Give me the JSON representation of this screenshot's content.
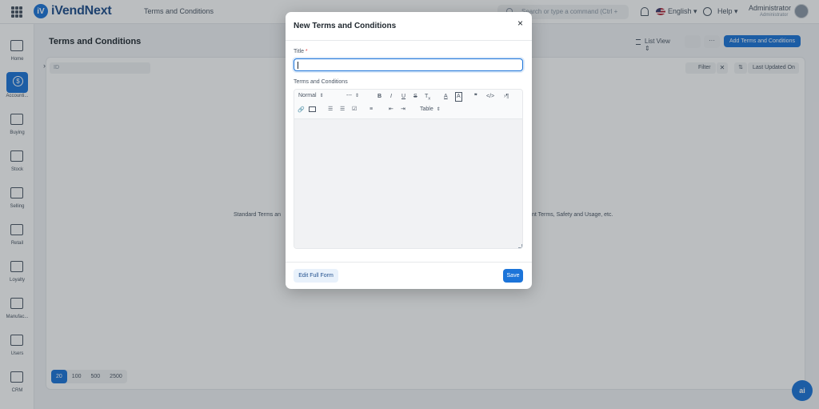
{
  "app": {
    "brand": "iVendNext",
    "logo_letters": "iV",
    "breadcrumb": "Terms and Conditions"
  },
  "header": {
    "search_placeholder": "Search or type a command (Ctrl + G)",
    "language": "English",
    "help": "Help",
    "user_name": "Administrator",
    "user_role": "Administrator"
  },
  "sidebar": {
    "items": [
      {
        "label": "Home",
        "icon": "home-icon"
      },
      {
        "label": "Accounti...",
        "icon": "dollar-icon"
      },
      {
        "label": "Buying",
        "icon": "cart-icon"
      },
      {
        "label": "Stock",
        "icon": "box-icon"
      },
      {
        "label": "Selling",
        "icon": "selling-icon"
      },
      {
        "label": "Retail",
        "icon": "barcode-icon"
      },
      {
        "label": "Loyalty",
        "icon": "loyalty-card-icon"
      },
      {
        "label": "Manufac...",
        "icon": "factory-icon"
      },
      {
        "label": "Users",
        "icon": "users-icon"
      },
      {
        "label": "CRM",
        "icon": "crm-icon"
      }
    ]
  },
  "page": {
    "title": "Terms and Conditions",
    "list_view": "List View",
    "add_button": "Add Terms and Conditions",
    "more": "···",
    "id_placeholder": "ID",
    "filter": "Filter",
    "clear": "✕",
    "sort": "Last Updated On",
    "empty_left": "Standard Terms an",
    "empty_right": "nt Terms, Safety and Usage, etc.",
    "paging": [
      "20",
      "100",
      "500",
      "2500"
    ],
    "ai_badge": "ai"
  },
  "dialog": {
    "title": "New Terms and Conditions",
    "close": "×",
    "title_label": "Title",
    "title_required": "*",
    "title_value": "",
    "terms_label": "Terms and Conditions",
    "toolbar": {
      "format": "Normal",
      "size": "---",
      "table": "Table"
    },
    "edit_full_form": "Edit Full Form",
    "save": "Save"
  },
  "colors": {
    "accent": "#1c74d9",
    "brand_text": "#1f4e8c"
  }
}
